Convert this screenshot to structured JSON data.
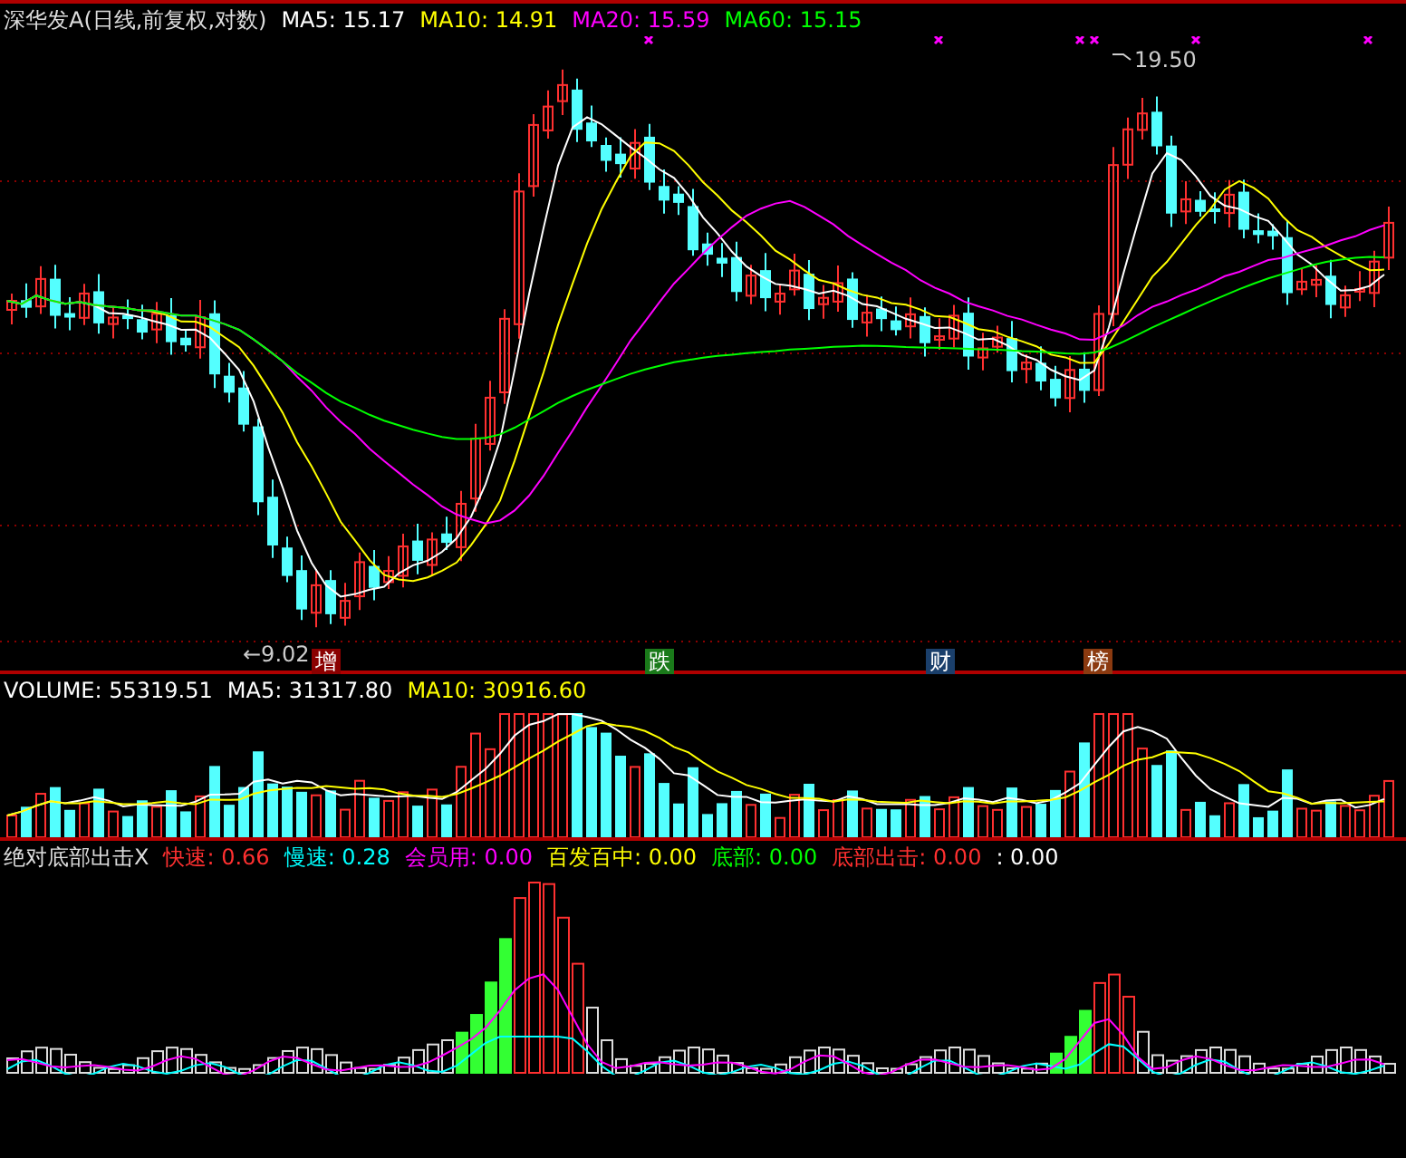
{
  "price_panel": {
    "title": "深华发A(日线,前复权,对数)",
    "indicators": [
      {
        "label": "MA5: 15.17",
        "color": "#ffffff"
      },
      {
        "label": "MA10: 14.91",
        "color": "#ffff00"
      },
      {
        "label": "MA20: 15.59",
        "color": "#ff00ff"
      },
      {
        "label": "MA60: 15.15",
        "color": "#00ff00"
      }
    ],
    "high_label": "19.50",
    "low_label": "←9.02",
    "badges": [
      {
        "text": "增",
        "color": "#8b0000"
      },
      {
        "text": "跌",
        "color": "#1a7a1a"
      },
      {
        "text": "财",
        "color": "#1a3f6b"
      },
      {
        "text": "榜",
        "color": "#8b3a10"
      }
    ]
  },
  "volume_panel": {
    "indicators": [
      {
        "label": "VOLUME: 55319.51",
        "color": "#ffffff"
      },
      {
        "label": "MA5: 31317.80",
        "color": "#ffffff"
      },
      {
        "label": "MA10: 30916.60",
        "color": "#ffff00"
      }
    ]
  },
  "indicator_panel": {
    "title": "绝对底部出击X",
    "indicators": [
      {
        "label": "快速: 0.66",
        "color": "#ff3030"
      },
      {
        "label": "慢速: 0.28",
        "color": "#00ffff"
      },
      {
        "label": "会员用: 0.00",
        "color": "#ff00ff"
      },
      {
        "label": "百发百中: 0.00",
        "color": "#ffff00"
      },
      {
        "label": "底部: 0.00",
        "color": "#00ff00"
      },
      {
        "label": "底部出击: 0.00",
        "color": "#ff3030"
      },
      {
        "label": ": 0.00",
        "color": "#ffffff"
      }
    ]
  }
}
